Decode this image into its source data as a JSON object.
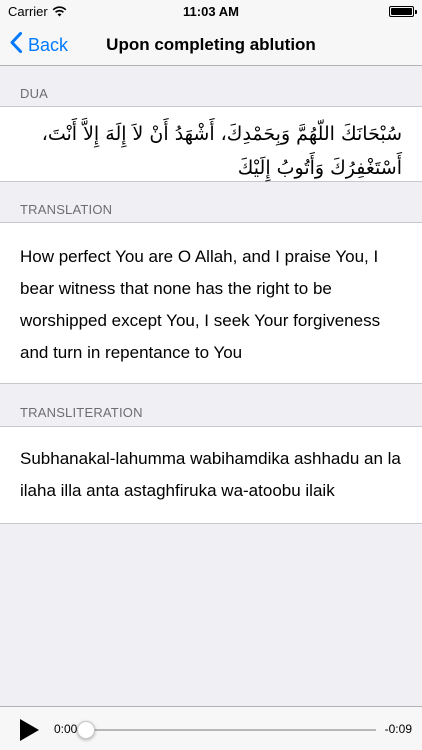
{
  "status_bar": {
    "carrier": "Carrier",
    "time": "11:03 AM",
    "battery_level": 1.0
  },
  "nav": {
    "back_label": "Back",
    "title": "Upon completing ablution"
  },
  "sections": {
    "dua": {
      "header": "DUA",
      "text": "سُبْحَانَكَ اللّهُمَّ وَبِحَمْدِكَ، أَشْهَدُ أَنْ لاَ إِلَهَ إِلاَّ أَنْتَ، أَسْتَغْفِرُكَ وَأَتُوبُ إِلَيْكَ"
    },
    "translation": {
      "header": "TRANSLATION",
      "text": "How perfect You are O Allah, and I praise You, I bear witness that none has the right to be worshipped except You, I seek Your forgiveness and turn in repentance to You"
    },
    "transliteration": {
      "header": "TRANSLITERATION",
      "text": "Subhanakal-lahumma wabihamdika ashhadu an la ilaha illa anta astaghfiruka wa-atoobu ilaik"
    }
  },
  "player": {
    "elapsed": "0:00",
    "remaining": "-0:09",
    "progress": 0.0
  },
  "colors": {
    "accent": "#007aff",
    "background": "#efeff4",
    "section_header": "#6d6d72"
  },
  "icons": {
    "back": "chevron-left-icon",
    "play": "play-icon",
    "wifi": "wifi-icon",
    "battery": "battery-icon"
  }
}
